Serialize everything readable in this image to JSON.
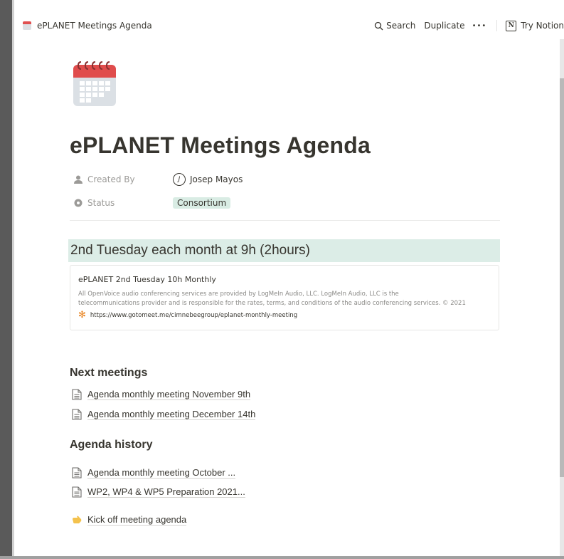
{
  "topbar": {
    "breadcrumb": "ePLANET Meetings Agenda",
    "search_label": "Search",
    "duplicate_label": "Duplicate",
    "more_label": "•••",
    "try_label": "Try Notion"
  },
  "page": {
    "title": "ePLANET Meetings Agenda",
    "properties": [
      {
        "label": "Created By",
        "value": "Josep Mayos",
        "avatar_letter": "J"
      },
      {
        "label": "Status",
        "value": "Consortium"
      }
    ]
  },
  "schedule": {
    "heading": "2nd Tuesday each month at 9h (2hours)",
    "bookmark": {
      "title": "ePLANET 2nd Tuesday 10h Monthly",
      "description_line1": "All OpenVoice audio conferencing services are provided by LogMeIn Audio, LLC. LogMeIn Audio, LLC is the",
      "description_line2": "telecommunications provider and is responsible for the rates, terms, and conditions of the audio conferencing services. © 2021",
      "url": "https://www.gotomeet.me/cimnebeegroup/eplanet-monthly-meeting"
    }
  },
  "next_meetings": {
    "heading": "Next meetings",
    "items": [
      "Agenda monthly meeting November 9th",
      "Agenda monthly meeting December 14th"
    ]
  },
  "agenda_history": {
    "heading": "Agenda history",
    "items": [
      "Agenda monthly meeting October ...",
      "WP2, WP4 & WP5 Preparation 2021..."
    ],
    "kickoff": "Kick off meeting agenda"
  },
  "colors": {
    "callout_bg": "#dcede7",
    "tag_bg": "#d9ece4",
    "calendar_red": "#e04c4c"
  }
}
